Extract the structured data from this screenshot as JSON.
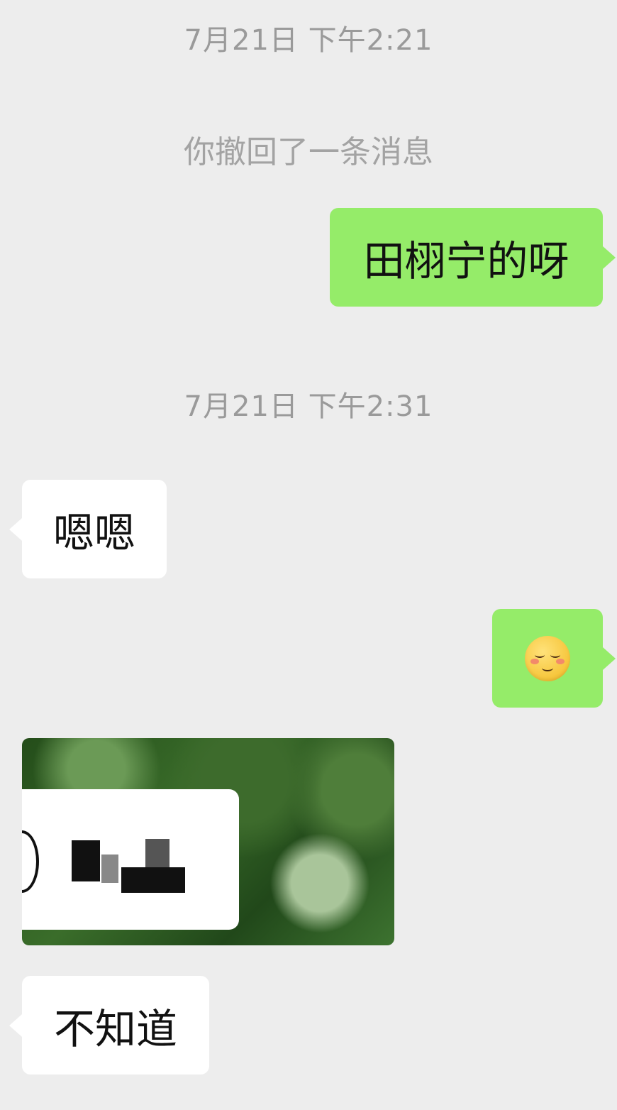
{
  "messages": {
    "time_1": "7月21日 下午2:21",
    "recall_notice": "你撤回了一条消息",
    "sent_1": "田栩宁的呀",
    "time_2": "7月21日 下午2:31",
    "received_1": "嗯嗯",
    "sent_emoji": "blushing-smile-emoji",
    "received_image": "photo",
    "received_2": "不知道"
  },
  "colors": {
    "background": "#ededed",
    "outgoing_bubble": "#95ec69",
    "incoming_bubble": "#ffffff",
    "timestamp_text": "#9a9a9a"
  }
}
